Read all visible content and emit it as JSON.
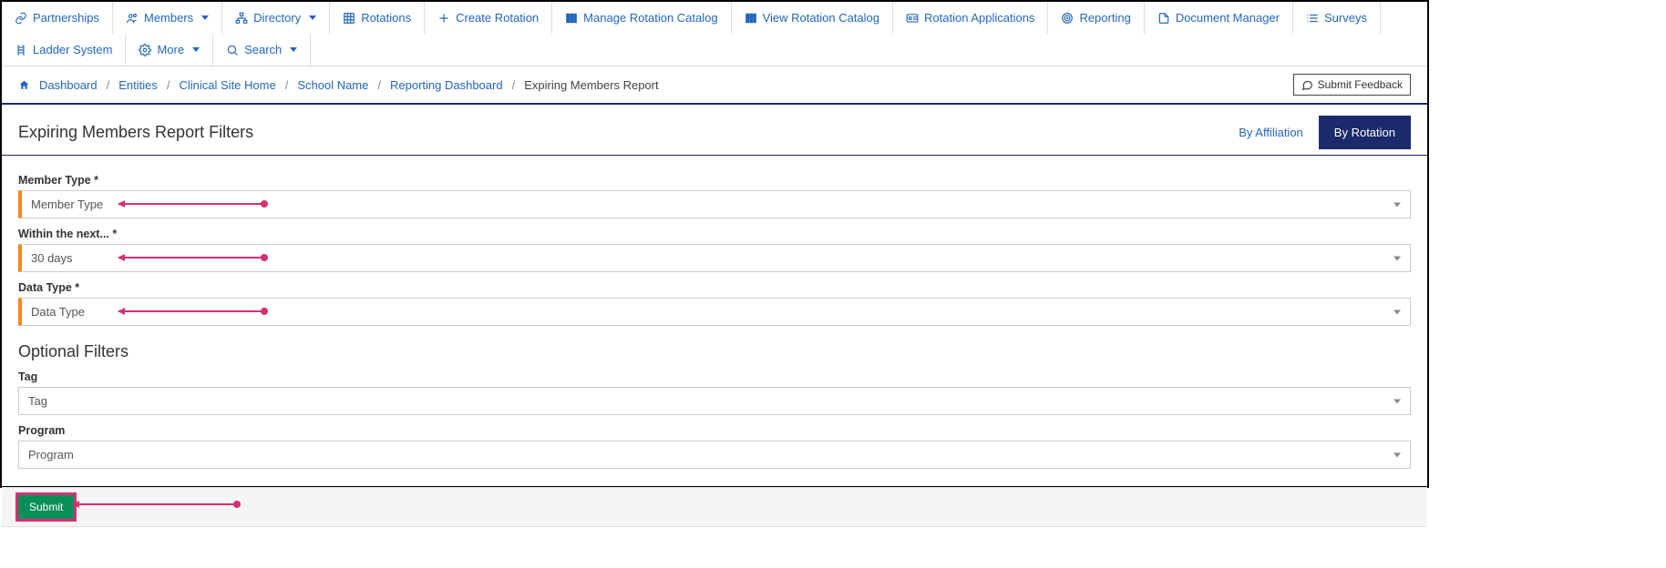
{
  "topnav": [
    {
      "icon": "link",
      "label": "Partnerships",
      "caret": false
    },
    {
      "icon": "users",
      "label": "Members",
      "caret": true
    },
    {
      "icon": "sitemap",
      "label": "Directory",
      "caret": true
    },
    {
      "icon": "grid",
      "label": "Rotations",
      "caret": false
    },
    {
      "icon": "plus",
      "label": "Create Rotation",
      "caret": false
    },
    {
      "icon": "books",
      "label": "Manage Rotation Catalog",
      "caret": false
    },
    {
      "icon": "books",
      "label": "View Rotation Catalog",
      "caret": false
    },
    {
      "icon": "card",
      "label": "Rotation Applications",
      "caret": false
    },
    {
      "icon": "target",
      "label": "Reporting",
      "caret": false
    },
    {
      "icon": "doc",
      "label": "Document Manager",
      "caret": false
    },
    {
      "icon": "list",
      "label": "Surveys",
      "caret": false
    },
    {
      "icon": "ladder",
      "label": "Ladder System",
      "caret": false
    },
    {
      "icon": "gear",
      "label": "More",
      "caret": true
    },
    {
      "icon": "search",
      "label": "Search",
      "caret": true
    }
  ],
  "breadcrumb": {
    "items": [
      "Dashboard",
      "Entities",
      "Clinical Site Home",
      "School Name",
      "Reporting Dashboard"
    ],
    "current": "Expiring Members Report"
  },
  "feedback_label": "Submit Feedback",
  "panel_title": "Expiring Members Report Filters",
  "tabs": {
    "by_affiliation": "By Affiliation",
    "by_rotation": "By Rotation"
  },
  "fields": {
    "member_type": {
      "label": "Member Type *",
      "value": "Member Type"
    },
    "within": {
      "label": "Within the next... *",
      "value": "30 days"
    },
    "data_type": {
      "label": "Data Type *",
      "value": "Data Type"
    }
  },
  "optional_title": "Optional Filters",
  "optional": {
    "tag": {
      "label": "Tag",
      "value": "Tag"
    },
    "program": {
      "label": "Program",
      "value": "Program"
    }
  },
  "submit_label": "Submit"
}
